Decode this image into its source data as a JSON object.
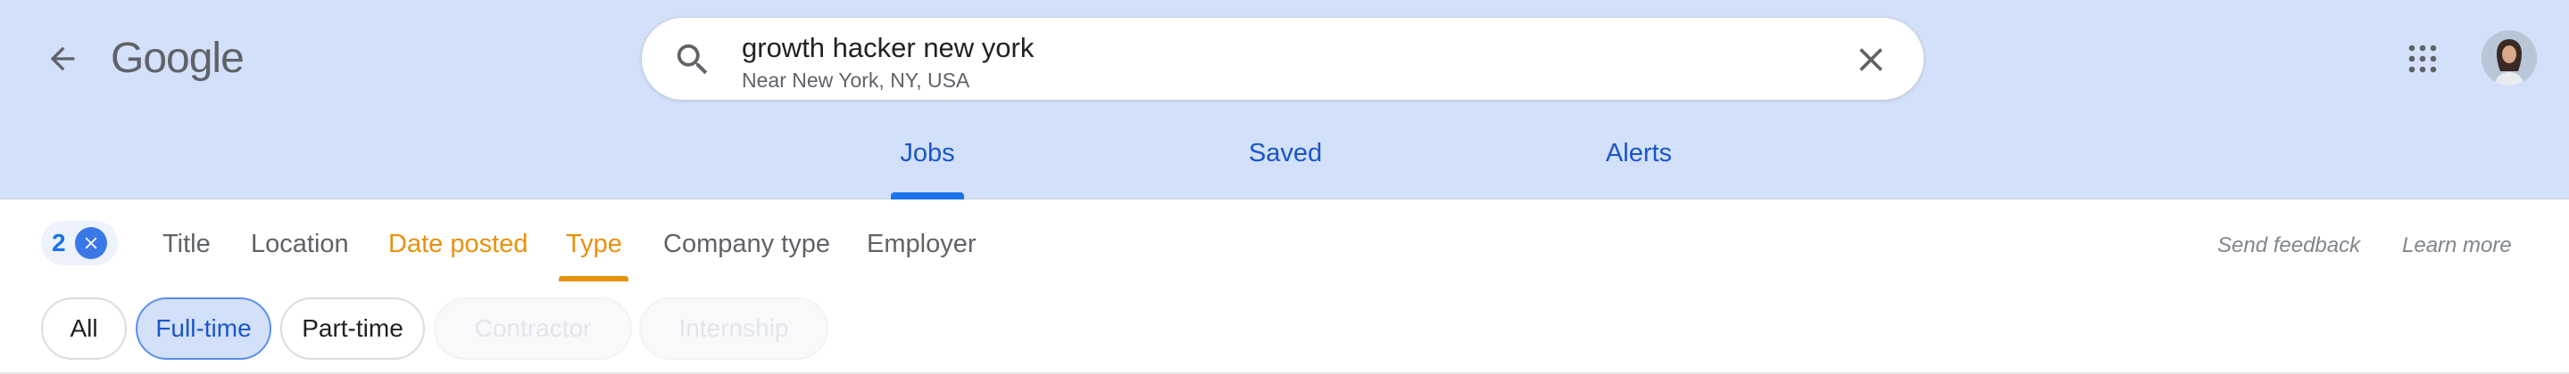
{
  "header": {
    "logo": "Google",
    "search": {
      "query": "growth hacker new york",
      "location": "Near New York, NY, USA"
    },
    "tabs": [
      {
        "label": "Jobs",
        "active": true
      },
      {
        "label": "Saved",
        "active": false
      },
      {
        "label": "Alerts",
        "active": false
      }
    ],
    "icons": {
      "back": "arrow-left-icon",
      "search": "search-icon",
      "clear": "close-icon",
      "apps": "apps-grid-icon"
    }
  },
  "filters": {
    "active_count": "2",
    "items": [
      {
        "label": "Title",
        "active": false
      },
      {
        "label": "Location",
        "active": false
      },
      {
        "label": "Date posted",
        "active": true
      },
      {
        "label": "Type",
        "active": true,
        "selected": true
      },
      {
        "label": "Company type",
        "active": false
      },
      {
        "label": "Employer",
        "active": false
      }
    ],
    "send_feedback": "Send feedback",
    "learn_more": "Learn more"
  },
  "type_chips": [
    {
      "label": "All",
      "state": "default"
    },
    {
      "label": "Full-time",
      "state": "selected"
    },
    {
      "label": "Part-time",
      "state": "default"
    },
    {
      "label": "Contractor",
      "state": "disabled"
    },
    {
      "label": "Internship",
      "state": "disabled"
    }
  ],
  "colors": {
    "header_bg": "#d3e0f9",
    "accent_blue": "#1a73e8",
    "accent_orange": "#e8910c"
  }
}
